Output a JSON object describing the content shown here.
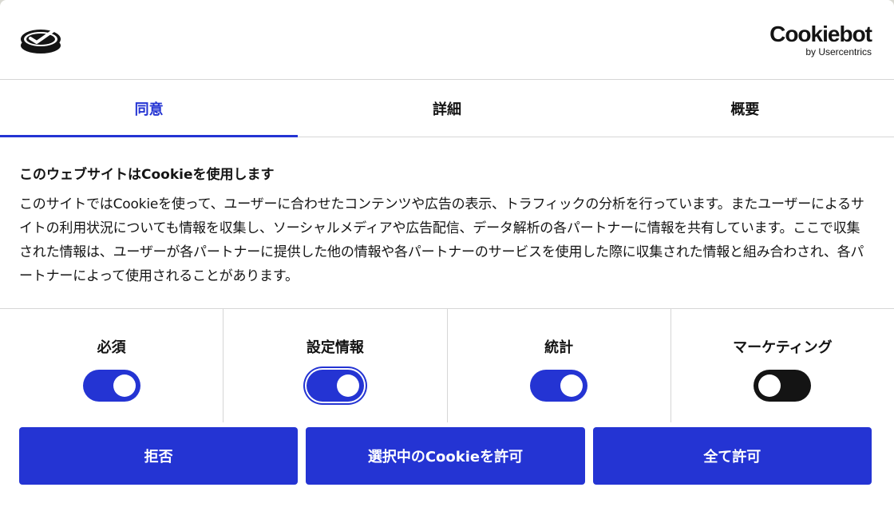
{
  "header": {
    "site_logo_icon": "checkmark-disc-icon",
    "cookiebot_name": "Cookiebot",
    "cookiebot_by": "by Usercentrics"
  },
  "tabs": [
    {
      "label": "同意",
      "active": true
    },
    {
      "label": "詳細",
      "active": false
    },
    {
      "label": "概要",
      "active": false
    }
  ],
  "content": {
    "title": "このウェブサイトはCookieを使用します",
    "body": "このサイトではCookieを使って、ユーザーに合わせたコンテンツや広告の表示、トラフィックの分析を行っています。またユーザーによるサイトの利用状況についても情報を収集し、ソーシャルメディアや広告配信、データ解析の各パートナーに情報を共有しています。ここで収集された情報は、ユーザーが各パートナーに提供した他の情報や各パートナーのサービスを使用した際に収集された情報と組み合わされ、各パートナーによって使用されることがあります。"
  },
  "toggles": [
    {
      "label": "必須",
      "on": true
    },
    {
      "label": "設定情報",
      "on": true
    },
    {
      "label": "統計",
      "on": true
    },
    {
      "label": "マーケティング",
      "on": false
    }
  ],
  "buttons": {
    "reject": "拒否",
    "allow_selected": "選択中のCookieを許可",
    "allow_all": "全て許可"
  },
  "colors": {
    "accent": "#2434d3",
    "off": "#141414"
  }
}
